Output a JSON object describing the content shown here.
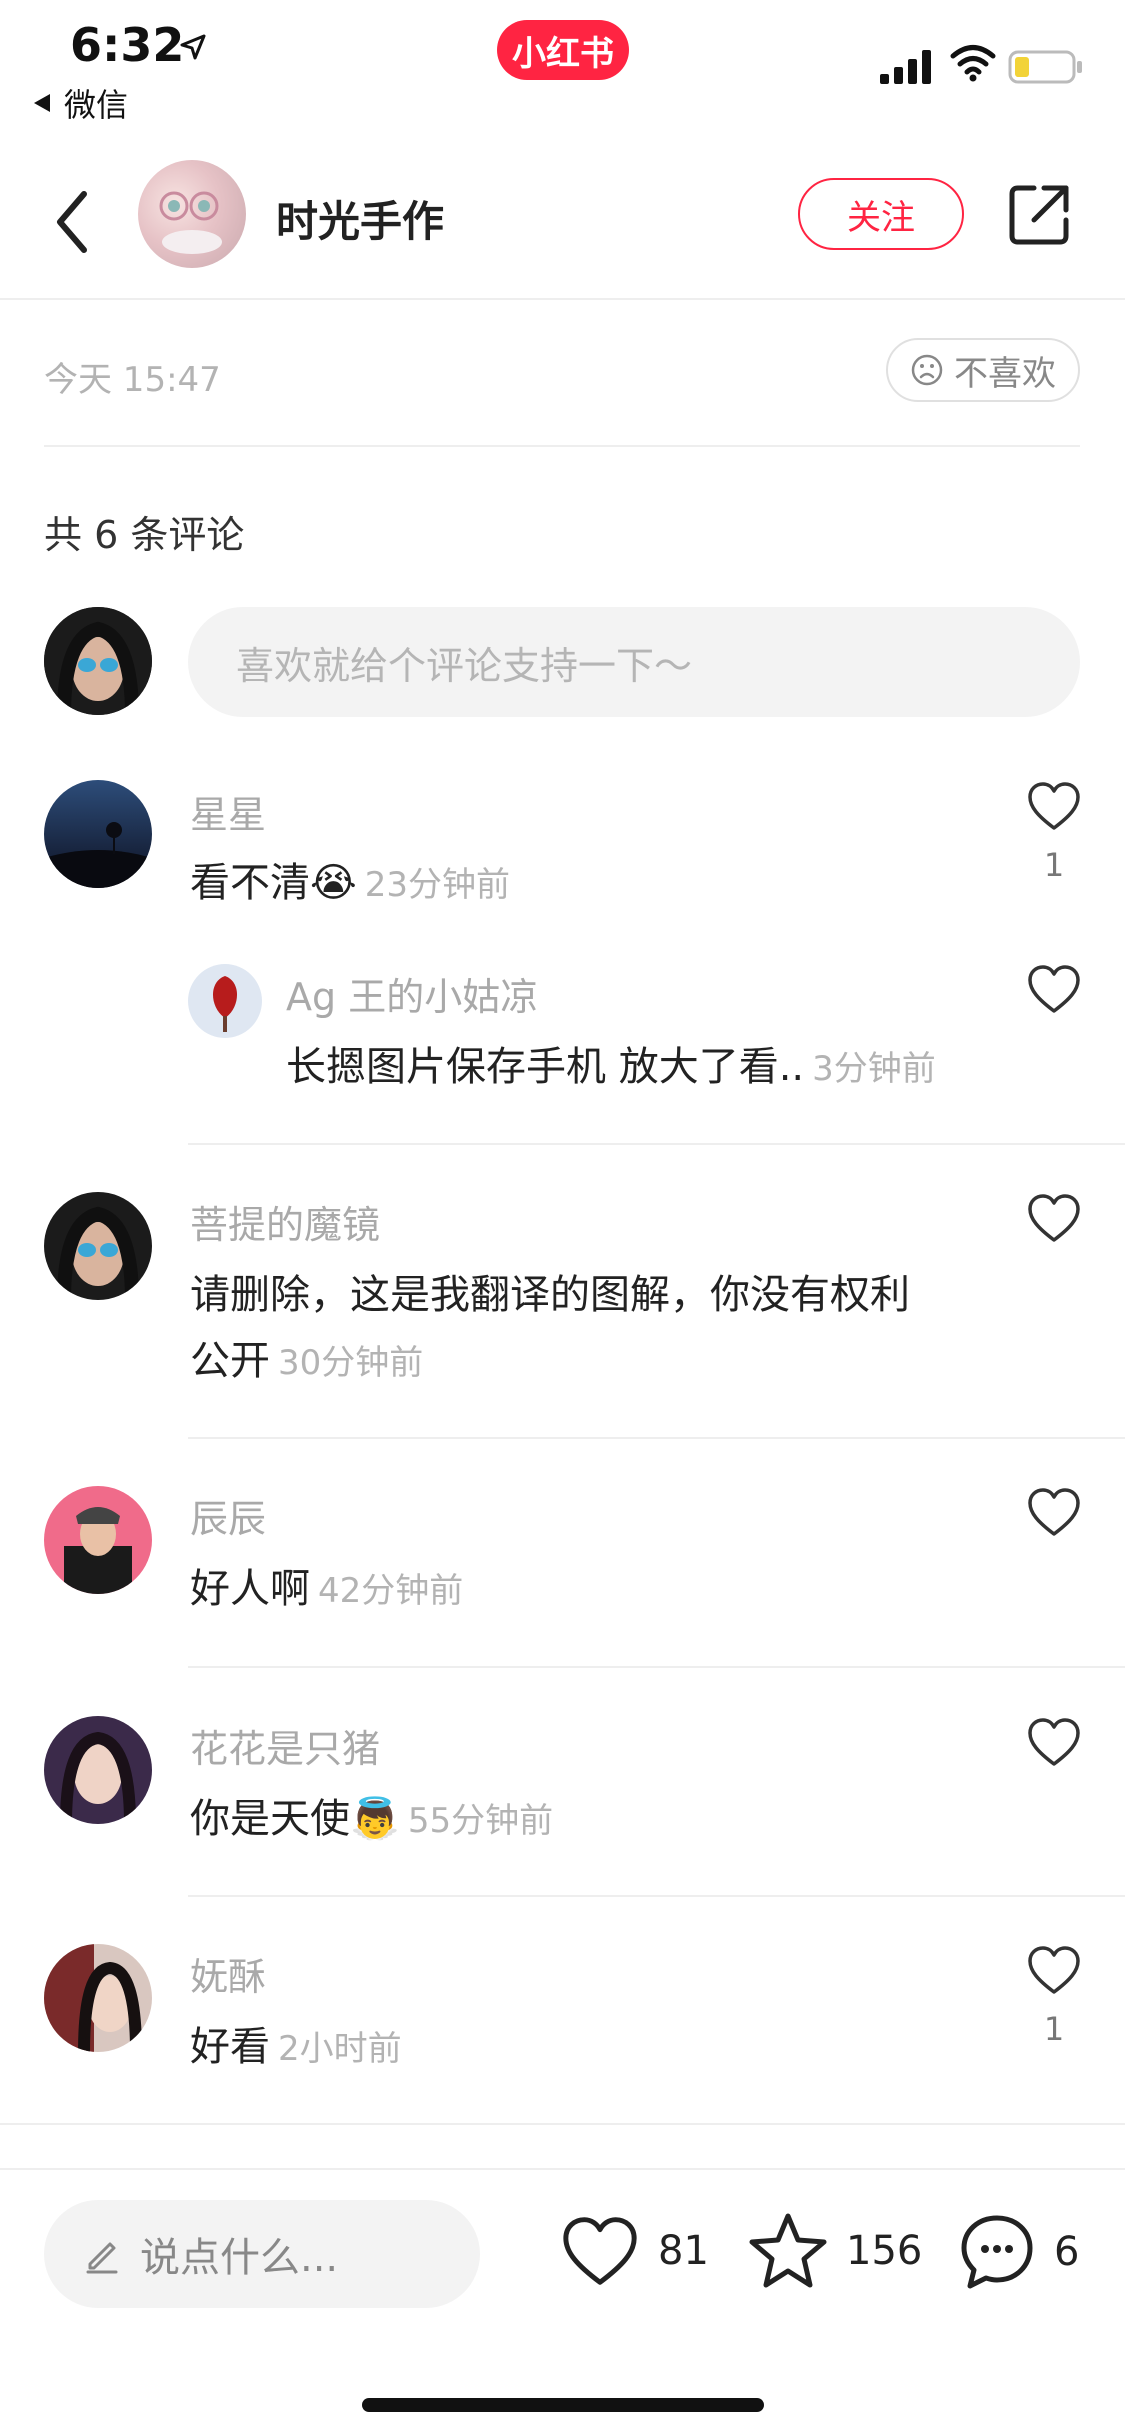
{
  "status_bar": {
    "time": "6:32",
    "back_app": "微信",
    "brand": "小红书"
  },
  "header": {
    "author_name": "时光手作",
    "follow_label": "关注"
  },
  "meta": {
    "post_time": "今天 15:47",
    "dislike_label": "不喜欢"
  },
  "comments_section": {
    "count_label": "共 6 条评论",
    "input_placeholder": "喜欢就给个评论支持一下～"
  },
  "comments": [
    {
      "name": "星星",
      "text": "看不清",
      "emoji": "😭",
      "time": "23分钟前",
      "likes": "1"
    },
    {
      "name": "Ag 王的小姑凉",
      "text": "长摁图片保存手机 放大了看..",
      "time": "3分钟前",
      "likes": ""
    },
    {
      "name": "菩提的魔镜",
      "text_line1": "请删除，这是我翻译的图解，你没有权利",
      "text_line2": "公开",
      "time": "30分钟前",
      "likes": ""
    },
    {
      "name": "辰辰",
      "text": "好人啊",
      "time": "42分钟前",
      "likes": ""
    },
    {
      "name": "花花是只猪",
      "text": "你是天使",
      "emoji": "👼",
      "time": "55分钟前",
      "likes": ""
    },
    {
      "name": "妩酥",
      "text": "好看",
      "time": "2小时前",
      "likes": "1"
    }
  ],
  "bottom_bar": {
    "say_placeholder": "说点什么...",
    "like_count": "81",
    "collect_count": "156",
    "comment_count": "6"
  },
  "colors": {
    "accent": "#ff2442",
    "muted": "#b3b3b3"
  }
}
